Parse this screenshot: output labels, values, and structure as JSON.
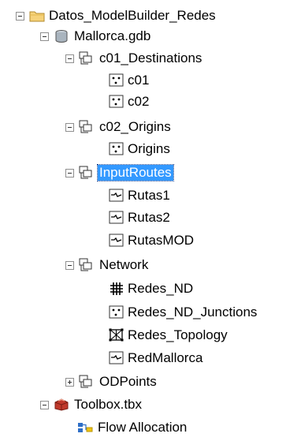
{
  "tree": {
    "root": "Datos_ModelBuilder_Redes",
    "gdb": "Mallorca.gdb",
    "dataset1": {
      "label": "c01_Destinations",
      "items": [
        "c01",
        "c02"
      ]
    },
    "dataset2": {
      "label": "c02_Origins",
      "items": [
        "Origins"
      ]
    },
    "dataset3": {
      "label": "InputRoutes",
      "items": [
        "Rutas1",
        "Rutas2",
        "RutasMOD"
      ]
    },
    "dataset4": {
      "label": "Network",
      "items": [
        "Redes_ND",
        "Redes_ND_Junctions",
        "Redes_Topology",
        "RedMallorca"
      ]
    },
    "dataset5": {
      "label": "ODPoints"
    },
    "toolbox": "Toolbox.tbx",
    "tool": "Flow Allocation"
  },
  "colors": {
    "selection": "#3399ff",
    "folder": "#f6d27a",
    "toolbox": "#c0392b",
    "expander_border": "#8f8f8f"
  },
  "icons": {
    "root": "folder-icon",
    "gdb": "geodatabase-icon",
    "dataset": "feature-dataset-icon",
    "point": "point-feature-class-icon",
    "line": "line-feature-class-icon",
    "network": "network-dataset-icon",
    "topology": "topology-icon",
    "toolbox": "toolbox-icon",
    "model": "model-tool-icon"
  }
}
